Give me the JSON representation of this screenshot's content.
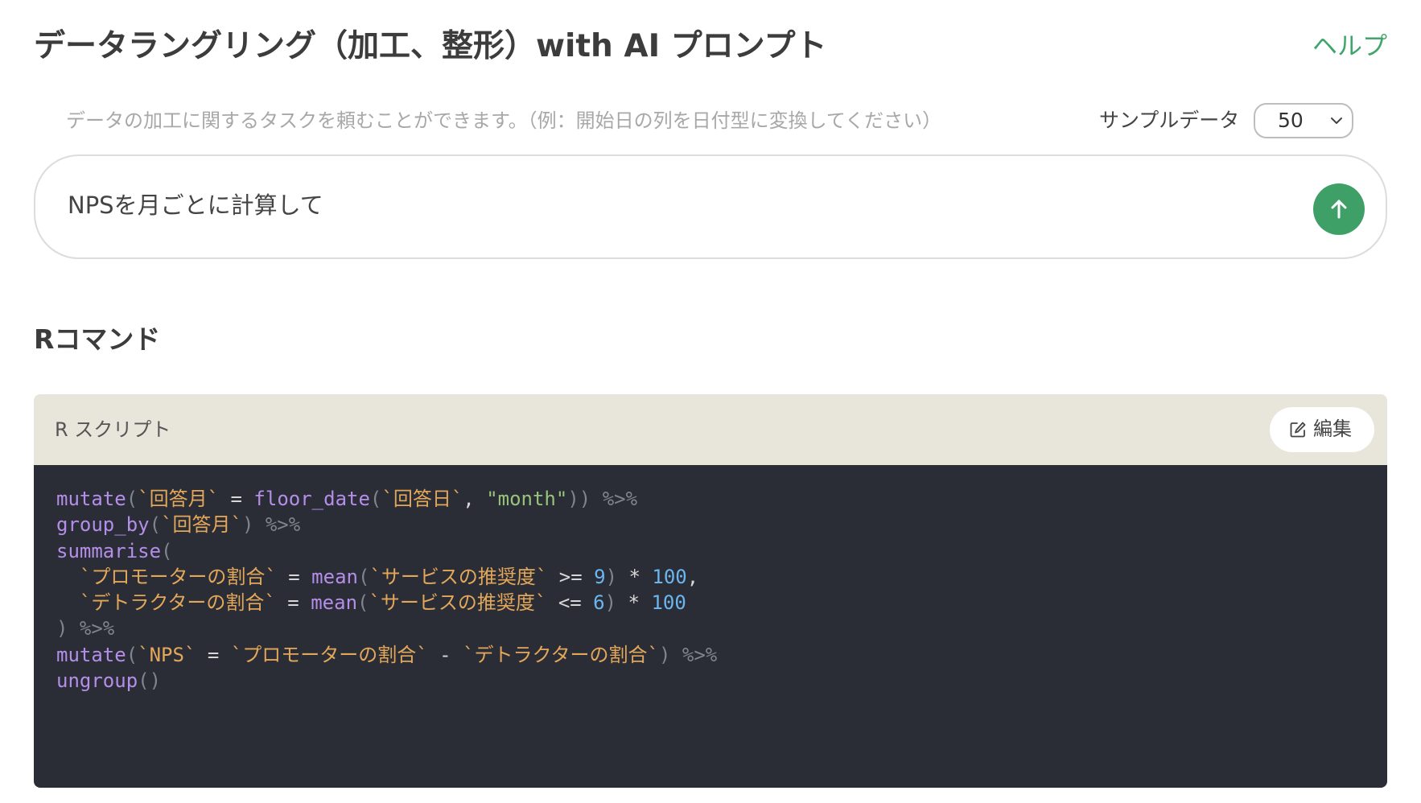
{
  "header": {
    "title": "データラングリング（加工、整形）with AI プロンプト",
    "help_label": "ヘルプ"
  },
  "prompt": {
    "hint": "データの加工に関するタスクを頼むことができます。（例：開始日の列を日付型に変換してください）",
    "sample_label": "サンプルデータ",
    "sample_value": "50",
    "input_value": "NPSを月ごとに計算して",
    "send_icon": "arrow-up-icon",
    "send_color": "#3fa067"
  },
  "section": {
    "heading": "Rコマンド"
  },
  "script": {
    "label": "R スクリプト",
    "edit_label": "編集",
    "edit_icon": "edit-icon",
    "header_bg": "#e8e5da",
    "code_bg": "#2a2d36",
    "lines": [
      [
        {
          "t": "mutate",
          "c": "fn"
        },
        {
          "t": "(",
          "c": "punc"
        },
        {
          "t": "`回答月`",
          "c": "var"
        },
        {
          "t": " = ",
          "c": "op"
        },
        {
          "t": "floor_date",
          "c": "fn"
        },
        {
          "t": "(",
          "c": "punc"
        },
        {
          "t": "`回答日`",
          "c": "var"
        },
        {
          "t": ", ",
          "c": "op"
        },
        {
          "t": "\"month\"",
          "c": "str"
        },
        {
          "t": "))",
          "c": "punc"
        },
        {
          "t": " %>%",
          "c": "pipe"
        }
      ],
      [
        {
          "t": "group_by",
          "c": "fn"
        },
        {
          "t": "(",
          "c": "punc"
        },
        {
          "t": "`回答月`",
          "c": "var"
        },
        {
          "t": ")",
          "c": "punc"
        },
        {
          "t": " %>%",
          "c": "pipe"
        }
      ],
      [
        {
          "t": "summarise",
          "c": "fn"
        },
        {
          "t": "(",
          "c": "punc"
        }
      ],
      [
        {
          "t": "  ",
          "c": "op"
        },
        {
          "t": "`プロモーターの割合`",
          "c": "var"
        },
        {
          "t": " = ",
          "c": "op"
        },
        {
          "t": "mean",
          "c": "fn"
        },
        {
          "t": "(",
          "c": "punc"
        },
        {
          "t": "`サービスの推奨度`",
          "c": "var"
        },
        {
          "t": " >= ",
          "c": "op"
        },
        {
          "t": "9",
          "c": "num"
        },
        {
          "t": ")",
          "c": "punc"
        },
        {
          "t": " * ",
          "c": "op"
        },
        {
          "t": "100",
          "c": "num"
        },
        {
          "t": ",",
          "c": "op"
        }
      ],
      [
        {
          "t": "  ",
          "c": "op"
        },
        {
          "t": "`デトラクターの割合`",
          "c": "var"
        },
        {
          "t": " = ",
          "c": "op"
        },
        {
          "t": "mean",
          "c": "fn"
        },
        {
          "t": "(",
          "c": "punc"
        },
        {
          "t": "`サービスの推奨度`",
          "c": "var"
        },
        {
          "t": " <= ",
          "c": "op"
        },
        {
          "t": "6",
          "c": "num"
        },
        {
          "t": ")",
          "c": "punc"
        },
        {
          "t": " * ",
          "c": "op"
        },
        {
          "t": "100",
          "c": "num"
        }
      ],
      [
        {
          "t": ")",
          "c": "punc"
        },
        {
          "t": " %>%",
          "c": "pipe"
        }
      ],
      [
        {
          "t": "mutate",
          "c": "fn"
        },
        {
          "t": "(",
          "c": "punc"
        },
        {
          "t": "`NPS`",
          "c": "var"
        },
        {
          "t": " = ",
          "c": "op"
        },
        {
          "t": "`プロモーターの割合`",
          "c": "var"
        },
        {
          "t": " - ",
          "c": "op"
        },
        {
          "t": "`デトラクターの割合`",
          "c": "var"
        },
        {
          "t": ")",
          "c": "punc"
        },
        {
          "t": " %>%",
          "c": "pipe"
        }
      ],
      [
        {
          "t": "ungroup",
          "c": "fn"
        },
        {
          "t": "()",
          "c": "punc"
        }
      ]
    ]
  }
}
